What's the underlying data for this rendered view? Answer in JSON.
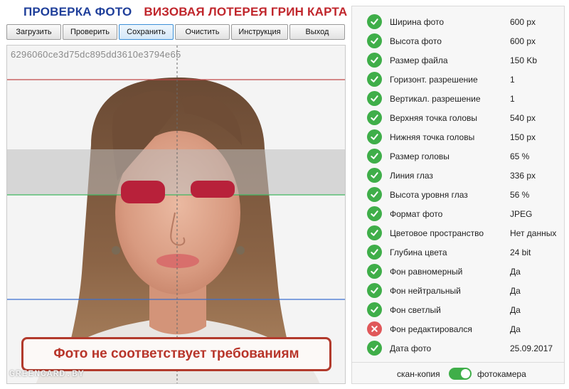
{
  "header": {
    "title_left": "ПРОВЕРКА ФОТО",
    "title_right": "ВИЗОВАЯ ЛОТЕРЕЯ ГРИН КАРТА",
    "colors": {
      "left": "#1f3f9a",
      "right": "#c0262c"
    }
  },
  "toolbar": {
    "buttons": [
      "Загрузить",
      "Проверить",
      "Сохранить",
      "Очистить",
      "Инструкция",
      "Выход"
    ],
    "active_label": "Сохранить"
  },
  "photo": {
    "hash": "6296060ce3d75dc895dd3610e3794e65",
    "warning": "Фото не соответствует требованиям",
    "watermark": "GREENCARD.BY"
  },
  "checks": [
    {
      "label": "Ширина фото",
      "value": "600 px",
      "status": "ok"
    },
    {
      "label": "Высота фото",
      "value": "600 px",
      "status": "ok"
    },
    {
      "label": "Размер файла",
      "value": "150 Kb",
      "status": "ok"
    },
    {
      "label": "Горизонт. разрешение",
      "value": "1",
      "status": "ok"
    },
    {
      "label": "Вертикал. разрешение",
      "value": "1",
      "status": "ok"
    },
    {
      "label": "Верхняя точка головы",
      "value": "540 px",
      "status": "ok"
    },
    {
      "label": "Нижняя точка головы",
      "value": "150 px",
      "status": "ok"
    },
    {
      "label": "Размер головы",
      "value": "65 %",
      "status": "ok"
    },
    {
      "label": "Линия глаз",
      "value": "336 px",
      "status": "ok"
    },
    {
      "label": "Высота уровня глаз",
      "value": "56 %",
      "status": "ok"
    },
    {
      "label": "Формат фото",
      "value": "JPEG",
      "status": "ok"
    },
    {
      "label": "Цветовое пространство",
      "value": "Нет данных",
      "status": "ok"
    },
    {
      "label": "Глубина цвета",
      "value": "24 bit",
      "status": "ok"
    },
    {
      "label": "Фон равномерный",
      "value": "Да",
      "status": "ok"
    },
    {
      "label": "Фон нейтральный",
      "value": "Да",
      "status": "ok"
    },
    {
      "label": "Фон светлый",
      "value": "Да",
      "status": "ok"
    },
    {
      "label": "Фон редактировался",
      "value": "Да",
      "status": "fail"
    },
    {
      "label": "Дата фото",
      "value": "25.09.2017",
      "status": "ok"
    }
  ],
  "mode_toggle": {
    "left_label": "скан-копия",
    "right_label": "фотокамера",
    "selected": "фотокамера"
  },
  "status_colors": {
    "ok": "#3fae49",
    "fail": "#e0585a"
  }
}
